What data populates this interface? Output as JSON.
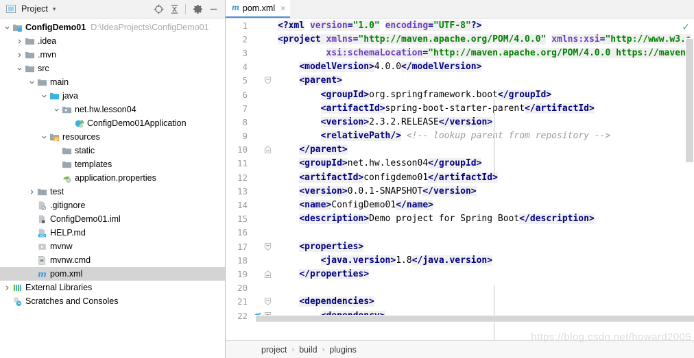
{
  "toolwindow": {
    "title": "Project",
    "caret": "▾",
    "icons": [
      {
        "name": "locate-icon",
        "label": "Select Opened File"
      },
      {
        "name": "collapse-all-icon",
        "label": "Collapse All"
      },
      {
        "name": "gear-icon",
        "label": "Settings"
      },
      {
        "name": "minimize-icon",
        "label": "Hide"
      }
    ],
    "tree": [
      {
        "label": "ConfigDemo01",
        "path": "D:\\IdeaProjects\\ConfigDemo01",
        "indent": 0,
        "arrow": "down",
        "icon": "module-folder-icon",
        "bold": true,
        "selected": false
      },
      {
        "label": ".idea",
        "path": "",
        "indent": 1,
        "arrow": "right",
        "icon": "folder-icon",
        "bold": false,
        "selected": false
      },
      {
        "label": ".mvn",
        "path": "",
        "indent": 1,
        "arrow": "right",
        "icon": "folder-icon",
        "bold": false,
        "selected": false
      },
      {
        "label": "src",
        "path": "",
        "indent": 1,
        "arrow": "down",
        "icon": "folder-icon",
        "bold": false,
        "selected": false
      },
      {
        "label": "main",
        "path": "",
        "indent": 2,
        "arrow": "down",
        "icon": "folder-icon",
        "bold": false,
        "selected": false
      },
      {
        "label": "java",
        "path": "",
        "indent": 3,
        "arrow": "down",
        "icon": "source-root-icon",
        "bold": false,
        "selected": false
      },
      {
        "label": "net.hw.lesson04",
        "path": "",
        "indent": 4,
        "arrow": "down",
        "icon": "package-icon",
        "bold": false,
        "selected": false
      },
      {
        "label": "ConfigDemo01Application",
        "path": "",
        "indent": 5,
        "arrow": "none",
        "icon": "spring-class-icon",
        "bold": false,
        "selected": false
      },
      {
        "label": "resources",
        "path": "",
        "indent": 3,
        "arrow": "down",
        "icon": "resource-root-icon",
        "bold": false,
        "selected": false
      },
      {
        "label": "static",
        "path": "",
        "indent": 4,
        "arrow": "none",
        "icon": "folder-icon",
        "bold": false,
        "selected": false
      },
      {
        "label": "templates",
        "path": "",
        "indent": 4,
        "arrow": "none",
        "icon": "folder-icon",
        "bold": false,
        "selected": false
      },
      {
        "label": "application.properties",
        "path": "",
        "indent": 4,
        "arrow": "none",
        "icon": "spring-properties-icon",
        "bold": false,
        "selected": false
      },
      {
        "label": "test",
        "path": "",
        "indent": 2,
        "arrow": "right",
        "icon": "folder-icon",
        "bold": false,
        "selected": false
      },
      {
        "label": ".gitignore",
        "path": "",
        "indent": 2,
        "arrow": "none",
        "icon": "gitignore-file-icon",
        "bold": false,
        "selected": false
      },
      {
        "label": "ConfigDemo01.iml",
        "path": "",
        "indent": 2,
        "arrow": "none",
        "icon": "iml-file-icon",
        "bold": false,
        "selected": false
      },
      {
        "label": "HELP.md",
        "path": "",
        "indent": 2,
        "arrow": "none",
        "icon": "markdown-file-icon",
        "bold": false,
        "selected": false
      },
      {
        "label": "mvnw",
        "path": "",
        "indent": 2,
        "arrow": "none",
        "icon": "script-file-icon",
        "bold": false,
        "selected": false
      },
      {
        "label": "mvnw.cmd",
        "path": "",
        "indent": 2,
        "arrow": "none",
        "icon": "cmd-file-icon",
        "bold": false,
        "selected": false
      },
      {
        "label": "pom.xml",
        "path": "",
        "indent": 2,
        "arrow": "none",
        "icon": "maven-file-icon",
        "bold": false,
        "selected": true
      },
      {
        "label": "External Libraries",
        "path": "",
        "indent": 0,
        "arrow": "right",
        "icon": "libraries-icon",
        "bold": false,
        "selected": false
      },
      {
        "label": "Scratches and Consoles",
        "path": "",
        "indent": 0,
        "arrow": "none",
        "icon": "scratches-icon",
        "bold": false,
        "selected": false
      }
    ]
  },
  "editor": {
    "tab": {
      "label": "pom.xml",
      "icon": "maven-file-icon",
      "close": "×"
    },
    "inspection_status": "✓",
    "lines": [
      {
        "num": "1",
        "fold": "none",
        "gutter_icon": "",
        "tokens": [
          {
            "t": "<?",
            "c": "t-tag"
          },
          {
            "t": "xml",
            "c": "t-tag"
          },
          {
            "t": " ",
            "c": "t-txt"
          },
          {
            "t": "version",
            "c": "t-attr"
          },
          {
            "t": "=",
            "c": "t-tag"
          },
          {
            "t": "\"1.0\"",
            "c": "t-val"
          },
          {
            "t": " ",
            "c": "t-txt"
          },
          {
            "t": "encoding",
            "c": "t-attr"
          },
          {
            "t": "=",
            "c": "t-tag"
          },
          {
            "t": "\"UTF-8\"",
            "c": "t-val"
          },
          {
            "t": "?>",
            "c": "t-tag"
          }
        ],
        "indent": 0
      },
      {
        "num": "2",
        "fold": "none",
        "gutter_icon": "",
        "tokens": [
          {
            "t": "<project ",
            "c": "t-tag"
          },
          {
            "t": "xmlns",
            "c": "t-attr"
          },
          {
            "t": "=",
            "c": "t-tag"
          },
          {
            "t": "\"http://maven.apache.org/POM/4.0.0\"",
            "c": "t-val"
          },
          {
            "t": " ",
            "c": "t-txt"
          },
          {
            "t": "xmlns:xsi",
            "c": "t-attr"
          },
          {
            "t": "=",
            "c": "t-tag"
          },
          {
            "t": "\"http://www.w3.o",
            "c": "t-val"
          }
        ],
        "indent": 0
      },
      {
        "num": "3",
        "fold": "none",
        "gutter_icon": "",
        "tokens": [
          {
            "t": "         ",
            "c": "t-txt"
          },
          {
            "t": "xsi:schemaLocation",
            "c": "t-attr"
          },
          {
            "t": "=",
            "c": "t-tag"
          },
          {
            "t": "\"http://maven.apache.org/POM/4.0.0 https://maven.",
            "c": "t-val"
          }
        ],
        "indent": 0
      },
      {
        "num": "4",
        "fold": "none",
        "gutter_icon": "",
        "tokens": [
          {
            "t": "    ",
            "c": "t-txt"
          },
          {
            "t": "<modelVersion>",
            "c": "t-tag"
          },
          {
            "t": "4.0.0",
            "c": "t-txt"
          },
          {
            "t": "</modelVersion>",
            "c": "t-tag"
          }
        ],
        "indent": 0
      },
      {
        "num": "5",
        "fold": "start",
        "gutter_icon": "",
        "tokens": [
          {
            "t": "    ",
            "c": "t-txt"
          },
          {
            "t": "<parent>",
            "c": "t-tag"
          }
        ],
        "indent": 0
      },
      {
        "num": "6",
        "fold": "none",
        "gutter_icon": "",
        "tokens": [
          {
            "t": "        ",
            "c": "t-txt"
          },
          {
            "t": "<groupId>",
            "c": "t-tag"
          },
          {
            "t": "org.springframework.boot",
            "c": "t-txt"
          },
          {
            "t": "</groupId>",
            "c": "t-tag"
          }
        ],
        "indent": 0
      },
      {
        "num": "7",
        "fold": "none",
        "gutter_icon": "",
        "tokens": [
          {
            "t": "        ",
            "c": "t-txt"
          },
          {
            "t": "<artifactId>",
            "c": "t-tag"
          },
          {
            "t": "spring-boot-starter-parent",
            "c": "t-txt"
          },
          {
            "t": "</artifactId>",
            "c": "t-tag"
          }
        ],
        "indent": 0
      },
      {
        "num": "8",
        "fold": "none",
        "gutter_icon": "",
        "tokens": [
          {
            "t": "        ",
            "c": "t-txt"
          },
          {
            "t": "<version>",
            "c": "t-tag"
          },
          {
            "t": "2.3.2.RELEASE",
            "c": "t-txt"
          },
          {
            "t": "</version>",
            "c": "t-tag"
          }
        ],
        "indent": 0
      },
      {
        "num": "9",
        "fold": "none",
        "gutter_icon": "",
        "tokens": [
          {
            "t": "        ",
            "c": "t-txt"
          },
          {
            "t": "<relativePath/>",
            "c": "t-tag"
          },
          {
            "t": " ",
            "c": "t-txt"
          },
          {
            "t": "<!-- lookup parent from repository -->",
            "c": "t-cmt"
          }
        ],
        "indent": 0
      },
      {
        "num": "10",
        "fold": "end",
        "gutter_icon": "",
        "tokens": [
          {
            "t": "    ",
            "c": "t-txt"
          },
          {
            "t": "</parent>",
            "c": "t-tag"
          }
        ],
        "indent": 0
      },
      {
        "num": "11",
        "fold": "none",
        "gutter_icon": "",
        "tokens": [
          {
            "t": "    ",
            "c": "t-txt"
          },
          {
            "t": "<groupId>",
            "c": "t-tag"
          },
          {
            "t": "net.hw.lesson04",
            "c": "t-txt"
          },
          {
            "t": "</groupId>",
            "c": "t-tag"
          }
        ],
        "indent": 0
      },
      {
        "num": "12",
        "fold": "none",
        "gutter_icon": "",
        "tokens": [
          {
            "t": "    ",
            "c": "t-txt"
          },
          {
            "t": "<artifactId>",
            "c": "t-tag"
          },
          {
            "t": "configdemo01",
            "c": "t-txt"
          },
          {
            "t": "</artifactId>",
            "c": "t-tag"
          }
        ],
        "indent": 0
      },
      {
        "num": "13",
        "fold": "none",
        "gutter_icon": "",
        "tokens": [
          {
            "t": "    ",
            "c": "t-txt"
          },
          {
            "t": "<version>",
            "c": "t-tag"
          },
          {
            "t": "0.0.1-SNAPSHOT",
            "c": "t-txt"
          },
          {
            "t": "</version>",
            "c": "t-tag"
          }
        ],
        "indent": 0
      },
      {
        "num": "14",
        "fold": "none",
        "gutter_icon": "",
        "tokens": [
          {
            "t": "    ",
            "c": "t-txt"
          },
          {
            "t": "<name>",
            "c": "t-tag"
          },
          {
            "t": "ConfigDemo01",
            "c": "t-txt"
          },
          {
            "t": "</name>",
            "c": "t-tag"
          }
        ],
        "indent": 0
      },
      {
        "num": "15",
        "fold": "none",
        "gutter_icon": "",
        "tokens": [
          {
            "t": "    ",
            "c": "t-txt"
          },
          {
            "t": "<description>",
            "c": "t-tag"
          },
          {
            "t": "Demo project for Spring Boot",
            "c": "t-txt"
          },
          {
            "t": "</description>",
            "c": "t-tag"
          }
        ],
        "indent": 0
      },
      {
        "num": "16",
        "fold": "none",
        "gutter_icon": "",
        "tokens": [],
        "indent": 0
      },
      {
        "num": "17",
        "fold": "start",
        "gutter_icon": "",
        "tokens": [
          {
            "t": "    ",
            "c": "t-txt"
          },
          {
            "t": "<properties>",
            "c": "t-tag"
          }
        ],
        "indent": 0
      },
      {
        "num": "18",
        "fold": "none",
        "gutter_icon": "",
        "tokens": [
          {
            "t": "        ",
            "c": "t-txt"
          },
          {
            "t": "<java.version>",
            "c": "t-tag"
          },
          {
            "t": "1.8",
            "c": "t-txt"
          },
          {
            "t": "</java.version>",
            "c": "t-tag"
          }
        ],
        "indent": 0
      },
      {
        "num": "19",
        "fold": "end",
        "gutter_icon": "",
        "tokens": [
          {
            "t": "    ",
            "c": "t-txt"
          },
          {
            "t": "</properties>",
            "c": "t-tag"
          }
        ],
        "indent": 0
      },
      {
        "num": "20",
        "fold": "none",
        "gutter_icon": "",
        "tokens": [],
        "indent": 0
      },
      {
        "num": "21",
        "fold": "start",
        "gutter_icon": "",
        "tokens": [
          {
            "t": "    ",
            "c": "t-txt"
          },
          {
            "t": "<dependencies>",
            "c": "t-tag"
          }
        ],
        "indent": 0
      },
      {
        "num": "22",
        "fold": "start",
        "gutter_icon": "maven-dependency-icon",
        "tokens": [
          {
            "t": "        ",
            "c": "t-txt"
          },
          {
            "t": "<dependency>",
            "c": "t-tag"
          }
        ],
        "indent": 0
      }
    ]
  },
  "breadcrumb": {
    "separator": "›",
    "items": [
      "project",
      "build",
      "plugins"
    ]
  },
  "watermark": "https://blog.csdn.net/howard2005",
  "colors": {
    "accent": "#4a90d9",
    "tag": "#000080",
    "attr": "#6a3fbb",
    "value": "#008000",
    "comment": "#9a9a9a",
    "selection": "#d4d4d4",
    "ok_check": "#59a869"
  }
}
